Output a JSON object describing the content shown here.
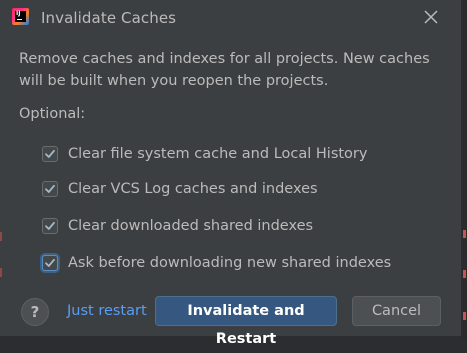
{
  "window": {
    "title": "Invalidate Caches",
    "app_icon": "intellij-idea-icon",
    "close_icon": "close-icon"
  },
  "message": "Remove caches and indexes for all projects. New caches will be built when you reopen the projects.",
  "optional_label": "Optional:",
  "options": [
    {
      "label": "Clear file system cache and Local History",
      "checked": true
    },
    {
      "label": "Clear VCS Log caches and indexes",
      "checked": true
    },
    {
      "label": "Clear downloaded shared indexes",
      "checked": true
    },
    {
      "label": "Ask before downloading new shared indexes",
      "checked": true,
      "focused": true
    }
  ],
  "footer": {
    "help_label": "?",
    "just_restart_label": "Just restart",
    "primary_label": "Invalidate and Restart",
    "cancel_label": "Cancel"
  },
  "colors": {
    "dialog_bg": "#3c3f41",
    "text": "#bbbbbb",
    "link": "#589df6",
    "primary_button": "#365880",
    "checkmark": "#a9b7c6"
  }
}
